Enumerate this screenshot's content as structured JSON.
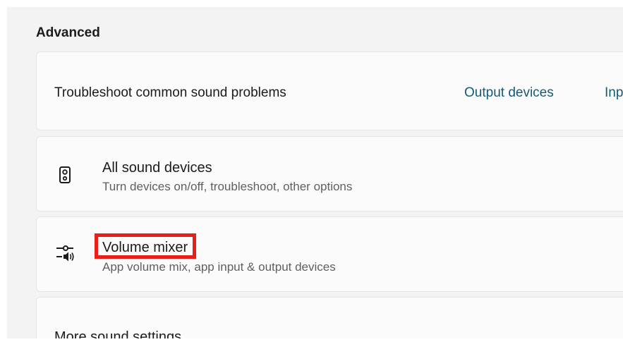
{
  "section": {
    "title": "Advanced"
  },
  "troubleshoot": {
    "label": "Troubleshoot common sound problems",
    "links": [
      {
        "label": "Output devices"
      },
      {
        "label": "Inp"
      }
    ]
  },
  "rows": [
    {
      "icon": "speaker-icon",
      "title": "All sound devices",
      "subtitle": "Turn devices on/off, troubleshoot, other options"
    },
    {
      "icon": "volume-mixer-icon",
      "title": "Volume mixer",
      "subtitle": "App volume mix, app input & output devices",
      "highlighted": true
    }
  ],
  "more": {
    "label": "More sound settings"
  },
  "colors": {
    "background": "#f3f3f3",
    "card": "#fbfbfb",
    "link": "#145a74",
    "highlight": "#e8201a"
  }
}
